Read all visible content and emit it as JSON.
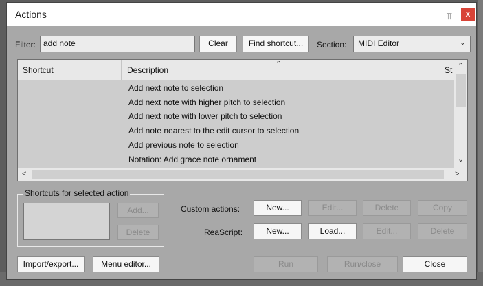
{
  "window": {
    "title": "Actions",
    "pin_glyph": "⫪",
    "close_glyph": "x"
  },
  "filter": {
    "label": "Filter:",
    "value": "add note",
    "clear_label": "Clear",
    "find_shortcut_label": "Find shortcut..."
  },
  "section": {
    "label": "Section:",
    "value": "MIDI Editor"
  },
  "table": {
    "columns": [
      "Shortcut",
      "Description",
      "St"
    ],
    "rows": [
      "Add next note to selection",
      "Add next note with higher pitch to selection",
      "Add next note with lower pitch to selection",
      "Add note nearest to the edit cursor to selection",
      "Add previous note to selection",
      "Notation: Add grace note ornament"
    ]
  },
  "shortcuts": {
    "legend": "Shortcuts for selected action",
    "add_label": "Add...",
    "delete_label": "Delete"
  },
  "custom_actions": {
    "label": "Custom actions:",
    "new_label": "New...",
    "edit_label": "Edit...",
    "delete_label": "Delete",
    "copy_label": "Copy"
  },
  "reascript": {
    "label": "ReaScript:",
    "new_label": "New...",
    "load_label": "Load...",
    "edit_label": "Edit...",
    "delete_label": "Delete"
  },
  "footer": {
    "import_export_label": "Import/export...",
    "menu_editor_label": "Menu editor...",
    "run_label": "Run",
    "run_close_label": "Run/close",
    "close_label": "Close"
  },
  "icons": {
    "sort": "chevron-up-icon",
    "scroll_up": "scroll-up-icon",
    "scroll_down": "scroll-down-icon",
    "scroll_left": "scroll-left-icon",
    "scroll_right": "scroll-right-icon"
  },
  "colors": {
    "close_button": "#d84438",
    "dialog_bg": "#a8a8a8",
    "list_bg": "#cdcdcd"
  }
}
